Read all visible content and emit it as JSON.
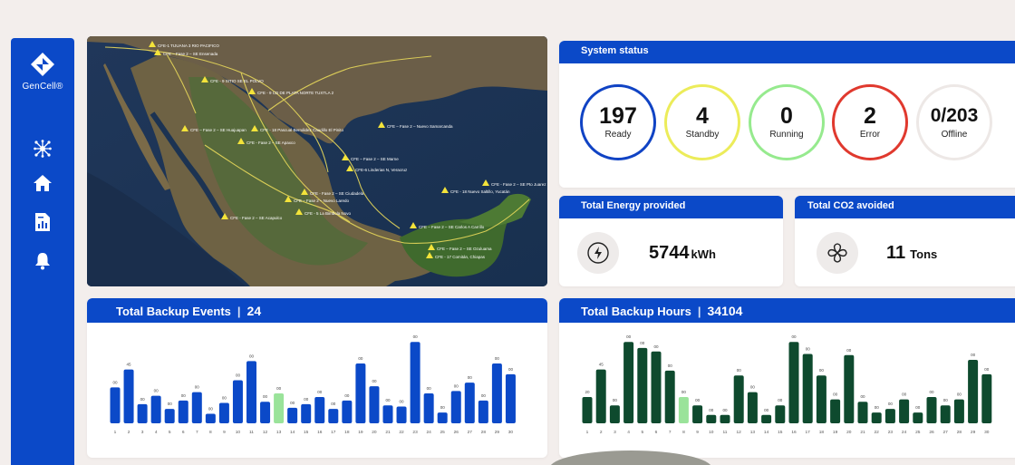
{
  "app": {
    "brand": "GenCell®"
  },
  "sidebar": {
    "items": [
      {
        "icon": "network-icon"
      },
      {
        "icon": "home-icon"
      },
      {
        "icon": "report-icon"
      },
      {
        "icon": "bell-icon"
      }
    ]
  },
  "map": {
    "labels": [
      "CFE-1 TIJUANA 3 RIO PACIFICO",
      "CFE – Fase 2 – SE Ensenada",
      "CFE – Fase 2 – SE Huajuapan",
      "CFE - 9 SITIO SE EL POLVO",
      "CFE - 9 CD DE PLATA NORTE TUXTLA 2",
      "CFE - Fase 2 – SE Apaxco",
      "CFE - 18 Pascual Bernáldez Caudillo El Pinito",
      "CFE – Fase 2 – Nuevo Samarcanda",
      "CFE – Fase 2 – SE Marne",
      "CFE-6 Linderias N, Veracruz",
      "CFE - Fase 2 – SE Pto Juarez",
      "CFE - 18 Nuevo Saltillo, Yucatán",
      "CFE - Fase 2 – SE Ciudadela",
      "CFE – Fase 2 – Nuevo Laredo",
      "CFE - 5 La Bimbola Novo",
      "CFE - Fase 2 – SE Acapulco",
      "CFE – Fase 2 – SE Carlos A Carrillo",
      "CFE – Fase 2 – SE Ozuluama",
      "CFE - 17 Comitán, Chiapas"
    ]
  },
  "status": {
    "title": "System status",
    "items": [
      {
        "value": "197",
        "label": "Ready",
        "color": "#1043c4"
      },
      {
        "value": "4",
        "label": "Standby",
        "color": "#ecec5a"
      },
      {
        "value": "0",
        "label": "Running",
        "color": "#96ea8e"
      },
      {
        "value": "2",
        "label": "Error",
        "color": "#e0392e"
      },
      {
        "value": "0/203",
        "label": "Offline",
        "color": "#ede8e6"
      }
    ]
  },
  "energy": {
    "title": "Total Energy provided",
    "value": "5744",
    "unit": "kWh",
    "icon": "lightning-circle-icon"
  },
  "co2": {
    "title": "Total CO2 avoided",
    "value": "11",
    "unit": "Tons",
    "icon": "leaf-flower-icon"
  },
  "events": {
    "title": "Total Backup Events",
    "separator": "|",
    "total": "24"
  },
  "hours": {
    "title": "Total Backup Hours",
    "separator": "|",
    "total": "34104"
  },
  "chart_data": [
    {
      "type": "bar",
      "color": "#0b49c8",
      "highlight_color": "#9ae39a",
      "highlight_index": 12,
      "categories": [
        "1",
        "2",
        "3",
        "4",
        "5",
        "6",
        "7",
        "8",
        "9",
        "10",
        "11",
        "12",
        "13",
        "14",
        "15",
        "16",
        "17",
        "18",
        "19",
        "20",
        "21",
        "22",
        "23",
        "24",
        "25",
        "26",
        "27",
        "28",
        "29",
        "30"
      ],
      "values": [
        30,
        45,
        16,
        23,
        12,
        19,
        26,
        8,
        17,
        36,
        52,
        18,
        25,
        13,
        16,
        22,
        12,
        19,
        50,
        31,
        15,
        14,
        68,
        25,
        9,
        27,
        34,
        19,
        50,
        41
      ],
      "data_labels": [
        "00",
        "45",
        "00",
        "00",
        "00",
        "00",
        "00",
        "00",
        "00",
        "00",
        "00",
        "00",
        "00",
        "00",
        "00",
        "00",
        "00",
        "00",
        "00",
        "00",
        "00",
        "00",
        "00",
        "00",
        "00",
        "00",
        "00",
        "00",
        "00",
        "00"
      ],
      "ylim": [
        0,
        75
      ]
    },
    {
      "type": "bar",
      "color": "#0e4a2e",
      "highlight_color": "#9ae39a",
      "highlight_index": 7,
      "categories": [
        "1",
        "2",
        "3",
        "4",
        "5",
        "6",
        "7",
        "8",
        "9",
        "10",
        "11",
        "12",
        "13",
        "14",
        "15",
        "16",
        "17",
        "18",
        "19",
        "20",
        "21",
        "22",
        "23",
        "24",
        "25",
        "26",
        "27",
        "28",
        "29",
        "30"
      ],
      "values": [
        22,
        45,
        15,
        68,
        63,
        60,
        44,
        22,
        15,
        7,
        7,
        40,
        26,
        7,
        15,
        68,
        58,
        40,
        20,
        57,
        18,
        9,
        12,
        20,
        9,
        22,
        15,
        20,
        53,
        41
      ],
      "data_labels": [
        "20",
        "45",
        "00",
        "00",
        "00",
        "00",
        "00",
        "00",
        "00",
        "00",
        "00",
        "00",
        "00",
        "00",
        "00",
        "00",
        "00",
        "00",
        "00",
        "00",
        "00",
        "00",
        "00",
        "00",
        "00",
        "00",
        "00",
        "00",
        "00",
        "00"
      ],
      "ylim": [
        0,
        75
      ]
    }
  ]
}
